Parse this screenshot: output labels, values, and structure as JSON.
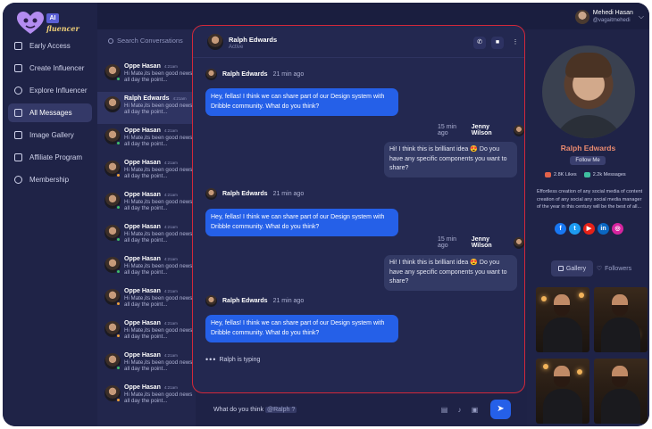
{
  "app": {
    "logo_badge": "AI",
    "logo_text": "fluencer"
  },
  "sidebar": {
    "items": [
      {
        "label": "Early Access",
        "icon": "home-icon"
      },
      {
        "label": "Create Influencer",
        "icon": "user-plus-icon"
      },
      {
        "label": "Explore Influencer",
        "icon": "scan-icon"
      },
      {
        "label": "All Messages",
        "icon": "message-icon",
        "active": true
      },
      {
        "label": "Image Gallery",
        "icon": "image-icon"
      },
      {
        "label": "Affiliate Program",
        "icon": "share-icon"
      },
      {
        "label": "Membership",
        "icon": "badge-icon"
      }
    ]
  },
  "user": {
    "name": "Mehedi Hasan",
    "handle": "@vagaitmehedi"
  },
  "search": {
    "placeholder": "Search Conversations"
  },
  "conversations": [
    {
      "name": "Oppe Hasan",
      "time": "4:21am",
      "msg": "Hi Mate,its been good news all day the point...",
      "status": "#3fbf6b"
    },
    {
      "name": "Ralph Edwards",
      "time": "4:21am",
      "msg": "Hi Mate,its been good news all day the point...",
      "status": ""
    },
    {
      "name": "Oppe Hasan",
      "time": "4:21am",
      "msg": "Hi Mate,its been good news all day the point...",
      "status": "#3fbf6b"
    },
    {
      "name": "Oppe Hasan",
      "time": "4:21am",
      "msg": "Hi Mate,its been good news all day the point...",
      "status": "#f0a23c"
    },
    {
      "name": "Oppe Hasan",
      "time": "4:21am",
      "msg": "Hi Mate,its been good news all day the point...",
      "status": "#3fbf6b"
    },
    {
      "name": "Oppe Hasan",
      "time": "4:21am",
      "msg": "Hi Mate,its been good news all day the point...",
      "status": "#3fbf6b"
    },
    {
      "name": "Oppe Hasan",
      "time": "4:21am",
      "msg": "Hi Mate,its been good news all day the point...",
      "status": "#3fbf6b"
    },
    {
      "name": "Oppe Hasan",
      "time": "4:21am",
      "msg": "Hi Mate,its been good news all day the point...",
      "status": "#f0a23c"
    },
    {
      "name": "Oppe Hasan",
      "time": "4:21am",
      "msg": "Hi Mate,its been good news all day the point...",
      "status": "#f0a23c"
    },
    {
      "name": "Oppe Hasan",
      "time": "4:21am",
      "msg": "Hi Mate,its been good news all day the point...",
      "status": "#3fbf6b"
    },
    {
      "name": "Oppe Hasan",
      "time": "4:21am",
      "msg": "Hi Mate,its been good news all day the point...",
      "status": "#f0a23c"
    }
  ],
  "chat": {
    "contact_name": "Ralph Edwards",
    "contact_status": "Active",
    "messages": [
      {
        "from": "Ralph Edwards",
        "time": "21 min ago",
        "text": "Hey, fellas! I think we can share part of our Design system with Dribble community. What do you think?"
      },
      {
        "from": "Jenny Wilson",
        "time": "15 min ago",
        "text": "Hi! I think this is brilliant idea 😍 Do you have any specific components you want to share?"
      },
      {
        "from": "Ralph Edwards",
        "time": "21 min ago",
        "text": "Hey, fellas! I think we can share part of our Design system with Dribble community. What do you think?"
      },
      {
        "from": "Jenny Wilson",
        "time": "15 min ago",
        "text": "Hi! I think this is brilliant idea 😍 Do you have any specific components you want to share?"
      },
      {
        "from": "Ralph Edwards",
        "time": "21 min ago",
        "text": "Hey, fellas! I think we can share part of our Design system with Dribble community. What do you think?"
      }
    ],
    "typing_text": "Ralph is typing"
  },
  "composer": {
    "text": "What do you think ",
    "mention": "@Ralph ?"
  },
  "profile": {
    "name": "Ralph Edwards",
    "follow_label": "Follow Me",
    "likes": "2.8K Likes",
    "messages": "2.2k Messages",
    "bio": "Effortless creation of any social media of content creation of any social any social media manager of the year in this century will be the best of all...",
    "tab_gallery": "Gallery",
    "tab_followers": "Followers"
  },
  "colors": {
    "accent": "#2560e8",
    "highlight_border": "#d2283a",
    "profile_name": "#e98a6f"
  }
}
